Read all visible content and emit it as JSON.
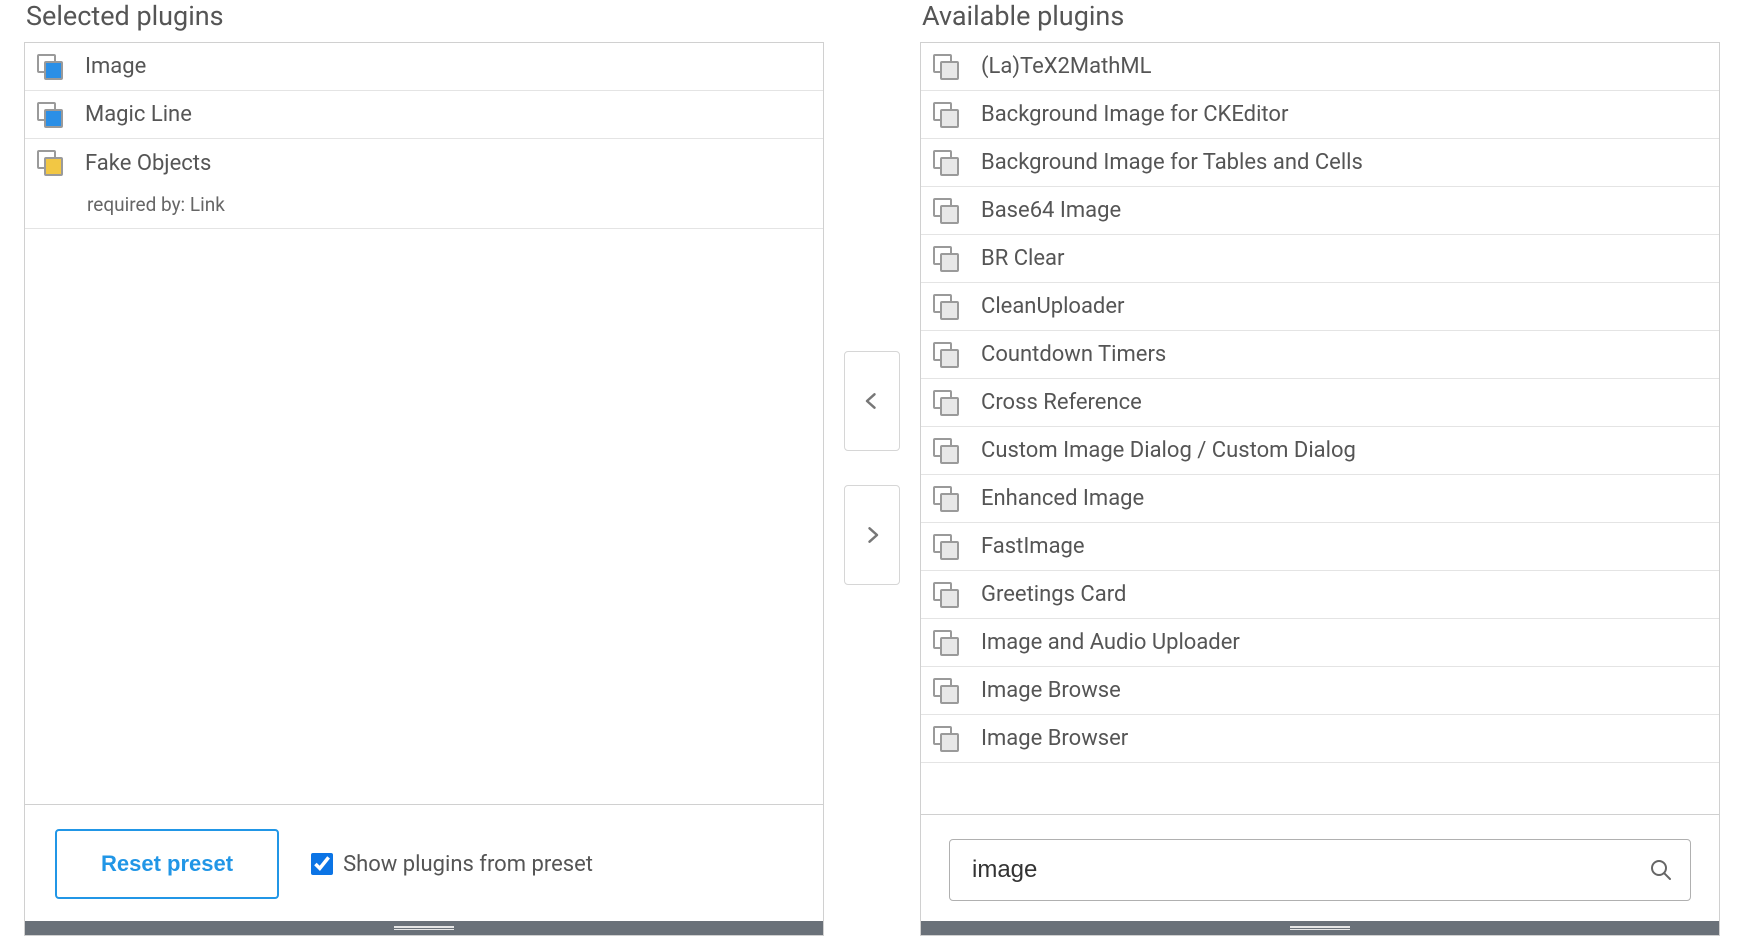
{
  "titles": {
    "selected": "Selected plugins",
    "available": "Available plugins"
  },
  "left": {
    "items": [
      {
        "label": "Image",
        "iconColor": "blue"
      },
      {
        "label": "Magic Line",
        "iconColor": "blue"
      },
      {
        "label": "Fake Objects",
        "iconColor": "yellow",
        "sub": "required by: Link"
      }
    ],
    "reset_label": "Reset preset",
    "show_from_preset_label": "Show plugins from preset",
    "show_from_preset_checked": true
  },
  "right": {
    "items": [
      {
        "label": "(La)TeX2MathML"
      },
      {
        "label": "Background Image for CKEditor"
      },
      {
        "label": "Background Image for Tables and Cells"
      },
      {
        "label": "Base64 Image"
      },
      {
        "label": "BR Clear"
      },
      {
        "label": "CleanUploader"
      },
      {
        "label": "Countdown Timers"
      },
      {
        "label": "Cross Reference"
      },
      {
        "label": "Custom Image Dialog / Custom Dialog"
      },
      {
        "label": "Enhanced Image"
      },
      {
        "label": "FastImage"
      },
      {
        "label": "Greetings Card"
      },
      {
        "label": "Image and Audio Uploader"
      },
      {
        "label": "Image Browse"
      },
      {
        "label": "Image Browser"
      }
    ],
    "search_value": "image"
  }
}
